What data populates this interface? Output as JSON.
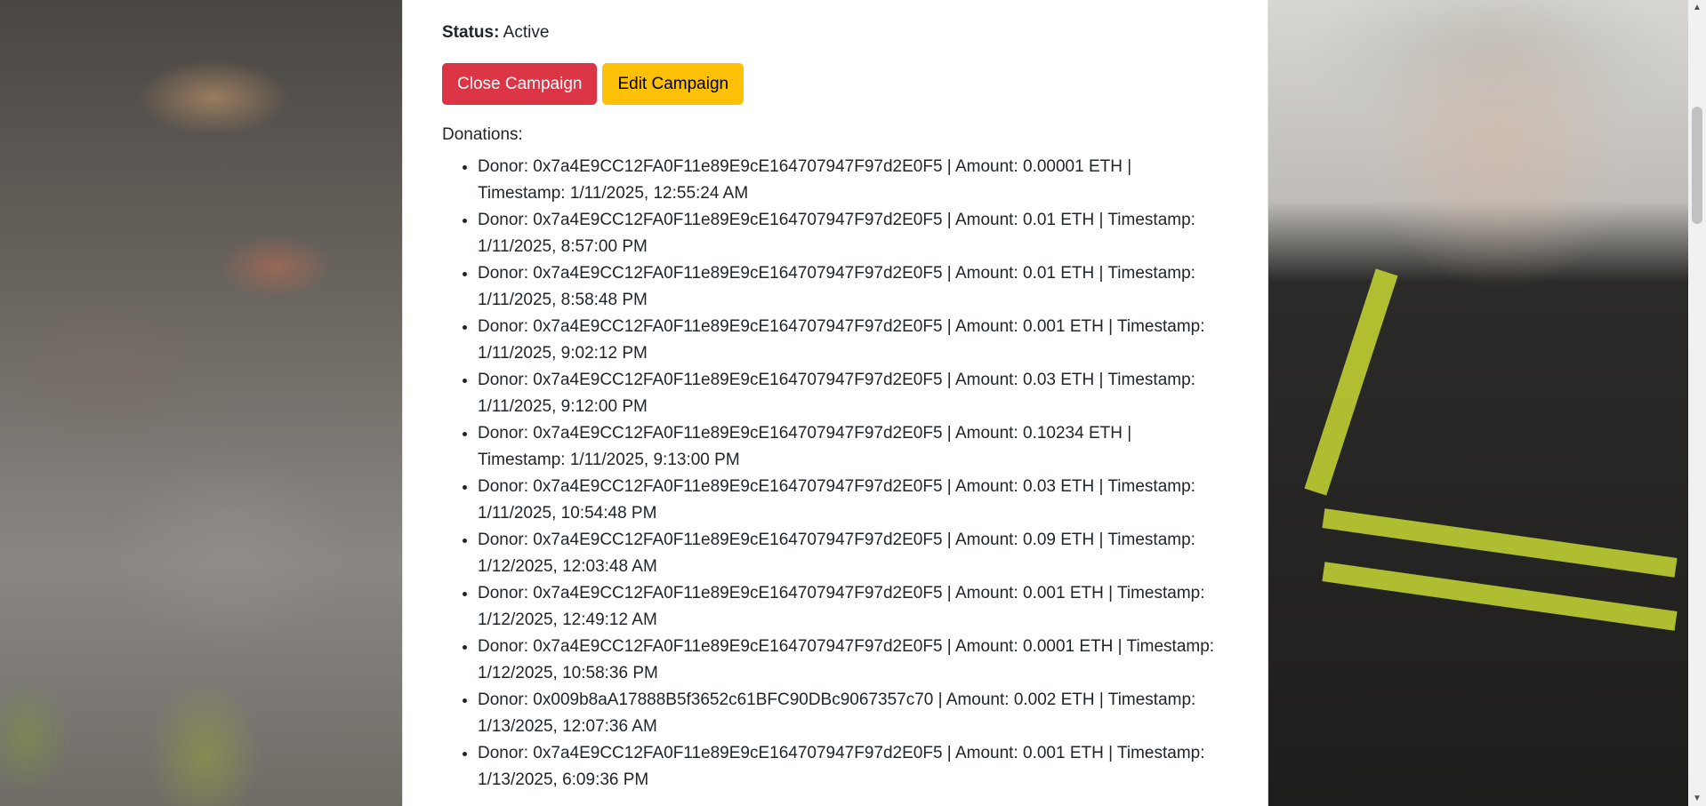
{
  "status": {
    "label": "Status:",
    "value": "Active"
  },
  "buttons": {
    "close": "Close Campaign",
    "edit": "Edit Campaign"
  },
  "donations_label": "Donations:",
  "donations": [
    "Donor: 0x7a4E9CC12FA0F11e89E9cE164707947F97d2E0F5 | Amount: 0.00001 ETH | Timestamp: 1/11/2025, 12:55:24 AM",
    "Donor: 0x7a4E9CC12FA0F11e89E9cE164707947F97d2E0F5 | Amount: 0.01 ETH | Timestamp: 1/11/2025, 8:57:00 PM",
    "Donor: 0x7a4E9CC12FA0F11e89E9cE164707947F97d2E0F5 | Amount: 0.01 ETH | Timestamp: 1/11/2025, 8:58:48 PM",
    "Donor: 0x7a4E9CC12FA0F11e89E9cE164707947F97d2E0F5 | Amount: 0.001 ETH | Timestamp: 1/11/2025, 9:02:12 PM",
    "Donor: 0x7a4E9CC12FA0F11e89E9cE164707947F97d2E0F5 | Amount: 0.03 ETH | Timestamp: 1/11/2025, 9:12:00 PM",
    "Donor: 0x7a4E9CC12FA0F11e89E9cE164707947F97d2E0F5 | Amount: 0.10234 ETH | Timestamp: 1/11/2025, 9:13:00 PM",
    "Donor: 0x7a4E9CC12FA0F11e89E9cE164707947F97d2E0F5 | Amount: 0.03 ETH | Timestamp: 1/11/2025, 10:54:48 PM",
    "Donor: 0x7a4E9CC12FA0F11e89E9cE164707947F97d2E0F5 | Amount: 0.09 ETH | Timestamp: 1/12/2025, 12:03:48 AM",
    "Donor: 0x7a4E9CC12FA0F11e89E9cE164707947F97d2E0F5 | Amount: 0.001 ETH | Timestamp: 1/12/2025, 12:49:12 AM",
    "Donor: 0x7a4E9CC12FA0F11e89E9cE164707947F97d2E0F5 | Amount: 0.0001 ETH | Timestamp: 1/12/2025, 10:58:36 PM",
    "Donor: 0x009b8aA17888B5f3652c61BFC90DBc9067357c70 | Amount: 0.002 ETH | Timestamp: 1/13/2025, 12:07:36 AM",
    "Donor: 0x7a4E9CC12FA0F11e89E9cE164707947F97d2E0F5 | Amount: 0.001 ETH | Timestamp: 1/13/2025, 6:09:36 PM"
  ],
  "colors": {
    "danger": "#dc3545",
    "warning": "#ffc107"
  },
  "icons": {
    "scroll_up": "triangle-up-icon",
    "scroll_down": "triangle-down-icon"
  }
}
